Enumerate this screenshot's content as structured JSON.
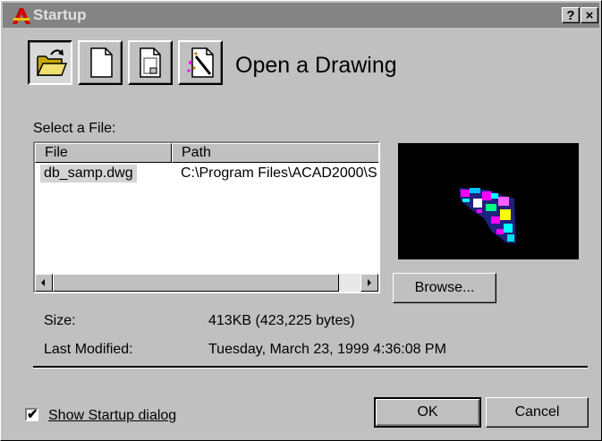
{
  "window": {
    "title": "Startup",
    "help_glyph": "?",
    "close_glyph": "×"
  },
  "toolbar": {
    "modes": [
      "open-drawing",
      "start-from-scratch",
      "use-template",
      "use-wizard"
    ],
    "active_mode": "open-drawing",
    "mode_title": "Open a Drawing"
  },
  "file_list": {
    "label": "Select a File:",
    "columns": [
      "File",
      "Path"
    ],
    "rows": [
      {
        "file": "db_samp.dwg",
        "path": "C:\\Program Files\\ACAD2000\\S"
      }
    ]
  },
  "buttons": {
    "browse": "Browse...",
    "ok": "OK",
    "cancel": "Cancel"
  },
  "details": {
    "size_label": "Size:",
    "size_value": "413KB (423,225 bytes)",
    "modified_label": "Last Modified:",
    "modified_value": "Tuesday, March 23, 1999  4:36:08 PM"
  },
  "footer": {
    "show_startup_label": "Show Startup dialog",
    "show_startup_checked": true,
    "check_glyph": "✔"
  }
}
